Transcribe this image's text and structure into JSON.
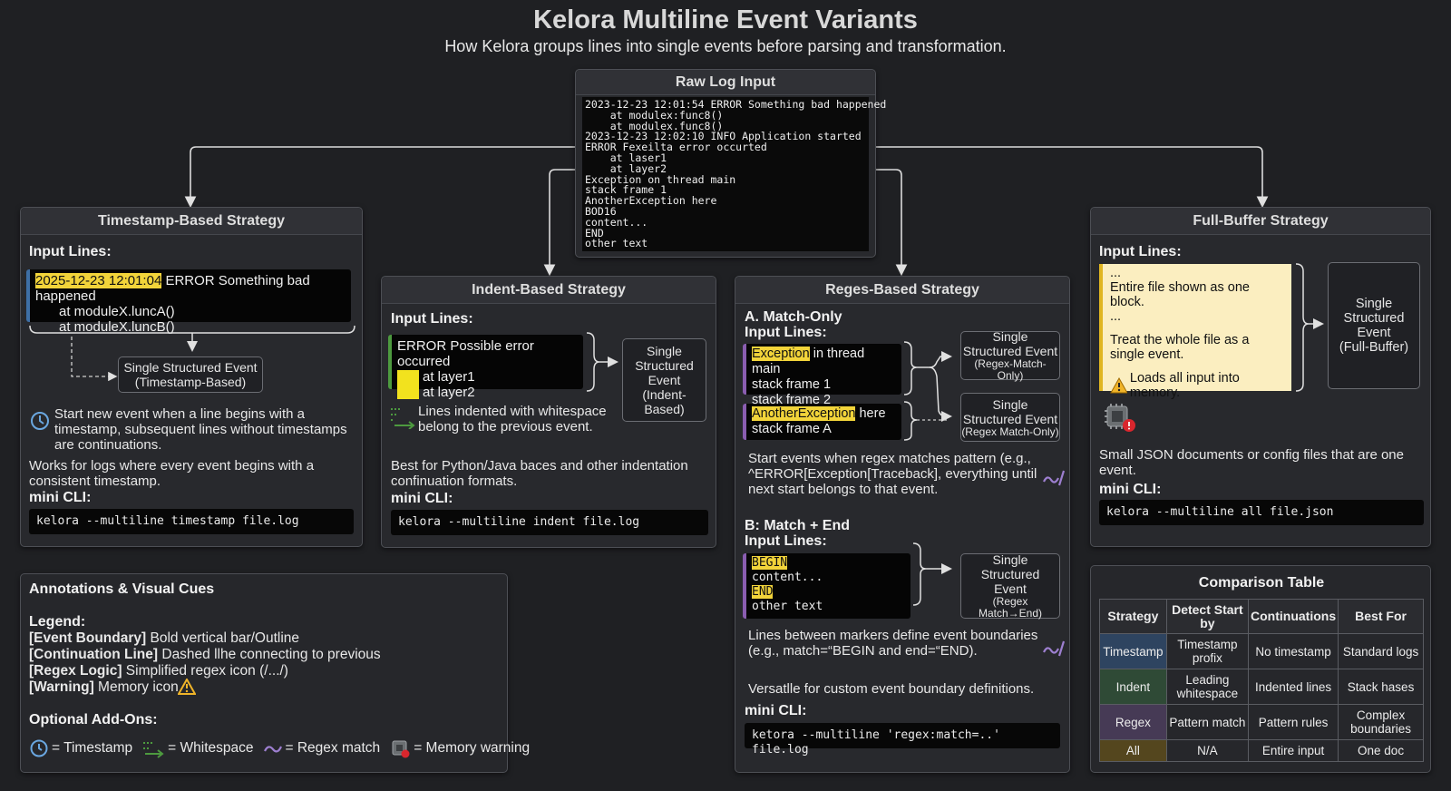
{
  "header": {
    "title": "Kelora Multiline Event Variants",
    "subtitle": "How Kelora groups lines into single events before parsing and transformation."
  },
  "raw": {
    "title": "Raw Log Input",
    "lines": [
      "2023-12-23 12:01:54 ERROR Something bad happened",
      "    at modulex:func8()",
      "    at modulex.func8()",
      "2023-12-23 12:02:10 INFO Application started",
      "ERROR Fexeilta error occurted",
      "    at laser1",
      "    at layer2",
      "Exception on thread main",
      "stack frame 1",
      "AnotherException here",
      "BOD16",
      "content...",
      "END",
      "other text"
    ]
  },
  "timestamp": {
    "title": "Timestamp-Based Strategy",
    "input_label": "Input Lines:",
    "line1_ts": "2025-12-23 12:01:04",
    "line1_rest": " ERROR Something bad happened",
    "line2": "at moduleX.luncA()",
    "line3": "at moduleX.luncB()",
    "event_line1": "Single Structured Event",
    "event_line2": "(Timestamp-Based)",
    "desc1": "Start new event when a line begins with a timestamp, subsequent lines without timestamps are continuations.",
    "desc2": "Works for logs where every event begins with a consistent timestamp.",
    "cli_label": "mini CLI:",
    "cli": "kelora --multiline timestamp file.log"
  },
  "indent": {
    "title": "Indent-Based Strategy",
    "input_label": "Input Lines:",
    "line1": "ERROR Possible error occurred",
    "line2": "at layer1",
    "line3": "at layer2",
    "event": [
      "Single",
      "Structured",
      "Event",
      "(Indent-",
      "Based)"
    ],
    "note": "Lines indented with whitespace belong to the previous event.",
    "desc": "Best for Python/Java baces and other indentation confinuation formats.",
    "cli_label": "mini CLI:",
    "cli": "kelora --multiline indent file.log"
  },
  "regex": {
    "title": "Reges-Based Strategy",
    "a_label": "A. Match-Only",
    "a_input": "Input Lines:",
    "a1_hl": "Exception",
    "a1_rest": " in thread main",
    "a2": "stack frame 1",
    "a3": "stack frame 2",
    "a4_hl": "AnotherException",
    "a4_rest": " here",
    "a5": "stack frame A",
    "a_event1": [
      "Single",
      "Structured Event",
      "(Regex-Match-Only)"
    ],
    "a_event2": [
      "Single",
      "Structured Event",
      "(Regex Match-Only)"
    ],
    "a_desc": "Start events when regex matches pattern (e.g., ^ERROR[Exception[Traceback], everything until next start belongs to that event.",
    "b_label": "B: Match + End",
    "b_input": "Input Lines:",
    "b1": "BEGIN",
    "b2": "content...",
    "b3": "END",
    "b4": "other text",
    "b_event": [
      "Single",
      "Structured",
      "Event",
      "(Regex",
      "Match→End)"
    ],
    "b_desc": "Lines between markers define event boundaries (e.g., match=“BEGIN and end=“END).",
    "b_desc2": "Versatlle for custom event boundary definitions.",
    "cli_label": "mini CLI:",
    "cli": "ketora --multiline 'regex:match=..' file.log"
  },
  "fullbuffer": {
    "title": "Full-Buffer Strategy",
    "input_label": "Input Lines:",
    "dots1": "...",
    "line1": "Entire file shown as one block.",
    "dots2": "...",
    "line2": "Treat the whole file as a single event.",
    "warn": "Loads all input into memory.",
    "event": [
      "Single",
      "Structured",
      "Event",
      "(Full-Buffer)"
    ],
    "desc": "Small JSON documents or config files that are one event.",
    "cli_label": "mini CLI:",
    "cli": "kelora --multiline all file.json"
  },
  "annotations": {
    "title": "Annotations & Visual Cues",
    "legend_label": "Legend:",
    "items": [
      {
        "key": "[Event Boundary]",
        "text": " Bold vertical bar/Outline"
      },
      {
        "key": "[Continuation Line]",
        "text": " Dashed llhe connecting to previous"
      },
      {
        "key": "[Regex Logic]",
        "text": " Simplified regex icon (/.../)"
      },
      {
        "key": "[Warning]",
        "text": " Memory icon"
      }
    ],
    "addons_label": "Optional Add-Ons:",
    "addons": [
      "= Timestamp",
      "= Whitespace",
      "= Regex match",
      "= Memory warning"
    ]
  },
  "comparison": {
    "title": "Comparison Table",
    "headers": [
      "Strategy",
      "Detect Start by",
      "Continuations",
      "Best For"
    ],
    "rows": [
      [
        "Timestamp",
        "Timestamp profix",
        "No timestamp",
        "Standard logs"
      ],
      [
        "Indent",
        "Leading whitespace",
        "Indented lines",
        "Stack hases"
      ],
      [
        "Regex",
        "Pattern match",
        "Pattern rules",
        "Complex boundaries"
      ],
      [
        "All",
        "N/A",
        "Entire input",
        "One doc"
      ]
    ],
    "row_colors": [
      "#2e4460",
      "#2f4a36",
      "#463a55",
      "#54461e"
    ]
  },
  "colors": {
    "highlight": "#f2d43a",
    "bar_timestamp": "#3e6fa5",
    "bar_indent": "#4d9a3f",
    "bar_regex": "#8a5db0",
    "warn": "#f0b429",
    "fullbuffer_bg": "#fbeec0"
  }
}
